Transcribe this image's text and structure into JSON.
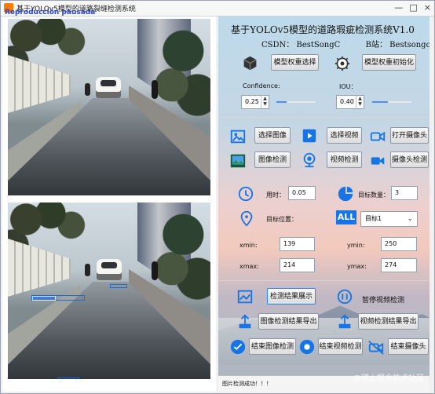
{
  "window": {
    "title": "基于YOLOv5模型的道路裂缝检测系统",
    "overlay_text": "Reproducción pausada",
    "minimize": "—",
    "maximize": "□",
    "close": "×"
  },
  "header": {
    "title": "基于YOLOv5模型的道路瑕疵检测系统V1.0",
    "csdn_label": "CSDN：",
    "csdn_value": "BestSongC",
    "bilibili_label": "B站：",
    "bilibili_value": "Bestsongc"
  },
  "model": {
    "select_button": "模型权重选择",
    "init_button": "模型权重初始化"
  },
  "params": {
    "confidence_label": "Confidence:",
    "iou_label": "IOU：",
    "confidence_value": "0.25",
    "iou_value": "0.40",
    "confidence_fraction": 0.25,
    "iou_fraction": 0.4
  },
  "actions": {
    "select_image": "选择图像",
    "select_video": "选择视频",
    "open_camera": "打开摄像头",
    "image_detect": "图像检测",
    "video_detect": "视频检测",
    "camera_detect": "摄像头检测"
  },
  "stats": {
    "time_label": "用时：",
    "time_value": "0.05",
    "target_count_label": "目标数量：",
    "target_count_value": "3",
    "target_position_label": "目标位置：",
    "target_select": "目标1",
    "xmin_label": "xmin:",
    "xmin_value": "139",
    "ymin_label": "ymin:",
    "ymin_value": "250",
    "xmax_label": "xmax:",
    "xmax_value": "214",
    "ymax_label": "ymax:",
    "ymax_value": "274",
    "all_label": "ALL"
  },
  "results": {
    "show_results": "检测结果展示",
    "pause_video": "暂停视频检测",
    "export_image": "图像检测结果导出",
    "export_video": "视频检测结果导出",
    "end_image": "结束图像检测",
    "end_video": "结束视频检测",
    "end_camera": "结束摄像头"
  },
  "status": {
    "message": "图片检测成功！！！",
    "watermark": "@稀土掘金技术社区"
  },
  "colors": {
    "accent": "#1675e6",
    "button_border": "#2b86ff",
    "detection_box": "#1c6ddb"
  }
}
